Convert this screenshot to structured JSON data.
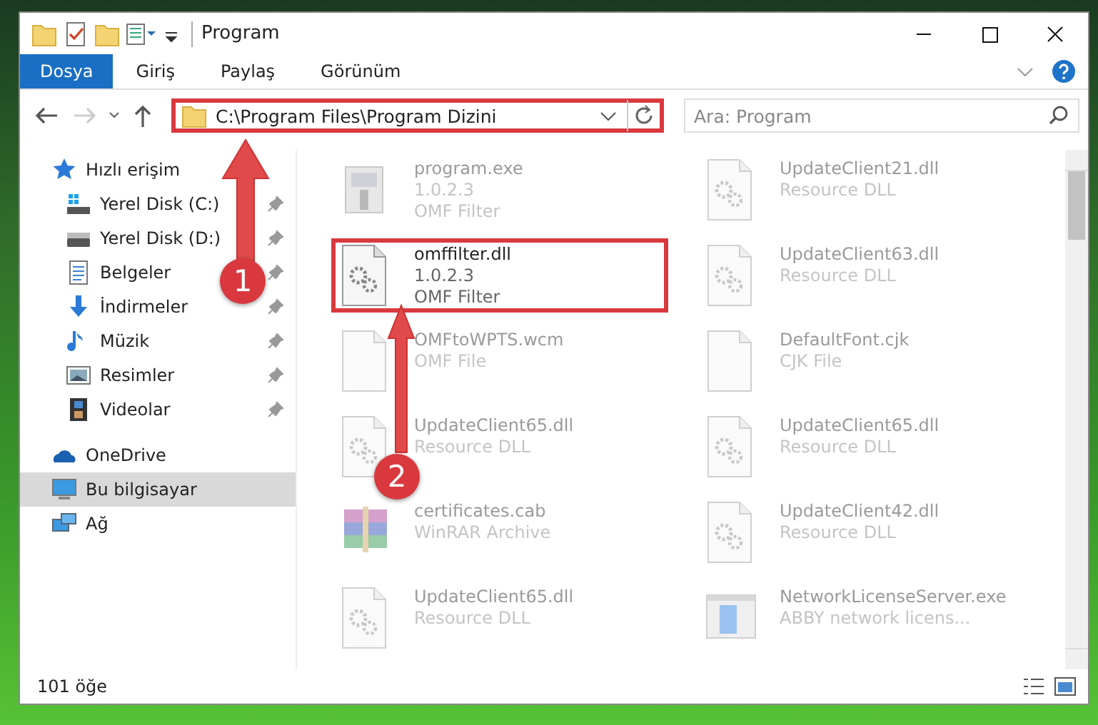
{
  "window": {
    "title": "Program"
  },
  "ribbon_tabs": [
    {
      "label": "Dosya",
      "selected": true
    },
    {
      "label": "Giriş",
      "selected": false
    },
    {
      "label": "Paylaş",
      "selected": false
    },
    {
      "label": "Görünüm",
      "selected": false
    }
  ],
  "address": {
    "path": "C:\\Program Files\\Program Dizini",
    "highlighted": true
  },
  "search": {
    "placeholder": "Ara: Program"
  },
  "sidebar": {
    "items": [
      {
        "label": "Hızlı erişim",
        "selected": false,
        "children": [
          {
            "label": "Yerel Disk (C:)",
            "pinned": true
          },
          {
            "label": "Yerel Disk (D:)",
            "pinned": true
          },
          {
            "label": "Belgeler",
            "pinned": true
          },
          {
            "label": "İndirmeler",
            "pinned": true
          },
          {
            "label": "Müzik",
            "pinned": true
          },
          {
            "label": "Resimler",
            "pinned": true
          },
          {
            "label": "Videolar",
            "pinned": true
          }
        ]
      },
      {
        "label": "OneDrive",
        "selected": false
      },
      {
        "label": "Bu bilgisayar",
        "selected": true
      },
      {
        "label": "Ağ",
        "selected": false
      }
    ]
  },
  "files": [
    {
      "name": "program.exe",
      "details": [
        "1.0.2.3",
        "OMF Filter"
      ],
      "kind": "exe",
      "faded": true,
      "highlighted": false
    },
    {
      "name": "UpdateClient21.dll",
      "details": [
        "Resource DLL"
      ],
      "kind": "dll",
      "faded": true,
      "highlighted": false
    },
    {
      "name": "omffilter.dll",
      "details": [
        "1.0.2.3",
        "OMF Filter"
      ],
      "kind": "dll",
      "faded": false,
      "highlighted": true
    },
    {
      "name": "UpdateClient63.dll",
      "details": [
        "Resource DLL"
      ],
      "kind": "dll",
      "faded": true,
      "highlighted": false
    },
    {
      "name": "OMFtoWPTS.wcm",
      "details": [
        "OMF File"
      ],
      "kind": "blank",
      "faded": true,
      "highlighted": false
    },
    {
      "name": "DefaultFont.cjk",
      "details": [
        "CJK File"
      ],
      "kind": "blank",
      "faded": true,
      "highlighted": false
    },
    {
      "name": "UpdateClient65.dll",
      "details": [
        "Resource DLL"
      ],
      "kind": "dll",
      "faded": true,
      "highlighted": false
    },
    {
      "name": "UpdateClient65.dll",
      "details": [
        "Resource DLL"
      ],
      "kind": "dll",
      "faded": true,
      "highlighted": false
    },
    {
      "name": "certificates.cab",
      "details": [
        "WinRAR Archive"
      ],
      "kind": "archive",
      "faded": true,
      "highlighted": false
    },
    {
      "name": "UpdateClient42.dll",
      "details": [
        "Resource DLL"
      ],
      "kind": "dll",
      "faded": true,
      "highlighted": false
    },
    {
      "name": "UpdateClient65.dll",
      "details": [
        "Resource DLL"
      ],
      "kind": "dll",
      "faded": true,
      "highlighted": false
    },
    {
      "name": "NetworkLicenseServer.exe",
      "details": [
        "ABBY network licens..."
      ],
      "kind": "app",
      "faded": true,
      "highlighted": false
    }
  ],
  "status_bar": {
    "item_count": "101 öğe"
  },
  "annotations": [
    {
      "number": "1"
    },
    {
      "number": "2"
    }
  ]
}
